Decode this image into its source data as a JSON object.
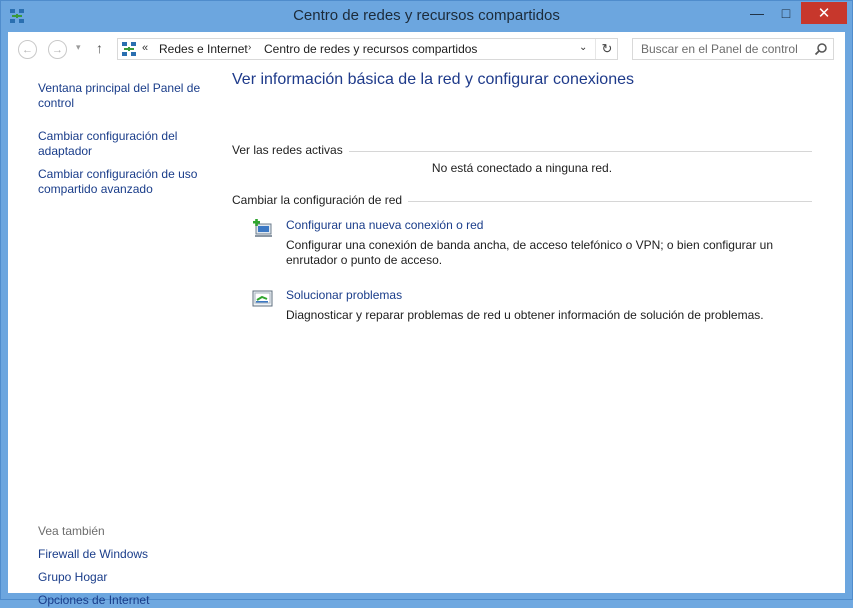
{
  "window": {
    "title": "Centro de redes y recursos compartidos"
  },
  "controls": {
    "minimize": "—",
    "maximize": "□",
    "close": "✕"
  },
  "navigation": {
    "back": "←",
    "forward": "→",
    "recent": "▾",
    "up": "↑",
    "breadcrumb_prefix": "«",
    "breadcrumb": [
      "Redes e Internet",
      "Centro de redes y recursos compartidos"
    ],
    "separator": "›",
    "dropdown": "⌄",
    "refresh": "↻"
  },
  "search": {
    "placeholder": "Buscar en el Panel de control"
  },
  "sidebar": {
    "links": [
      "Ventana principal del Panel de control",
      "Cambiar configuración del adaptador",
      "Cambiar configuración de uso compartido avanzado"
    ],
    "see_also_title": "Vea también",
    "see_also": [
      "Firewall de Windows",
      "Grupo Hogar",
      "Opciones de Internet"
    ]
  },
  "main": {
    "title": "Ver información básica de la red y configurar conexiones",
    "active_networks": {
      "title": "Ver las redes activas",
      "status": "No está conectado a ninguna red."
    },
    "change_settings": {
      "title": "Cambiar la configuración de red",
      "tasks": [
        {
          "label": "Configurar una nueva conexión o red",
          "description": "Configurar una conexión de banda ancha, de acceso telefónico o VPN; o bien configurar un enrutador o punto de acceso.",
          "icon": "new-connection-icon"
        },
        {
          "label": "Solucionar problemas",
          "description": "Diagnosticar y reparar problemas de red u obtener información de solución de problemas.",
          "icon": "troubleshoot-icon"
        }
      ]
    }
  },
  "colors": {
    "frame": "#6ca6df",
    "link": "#1a3d8a",
    "title": "#1e3a8a",
    "close": "#c7372c"
  }
}
